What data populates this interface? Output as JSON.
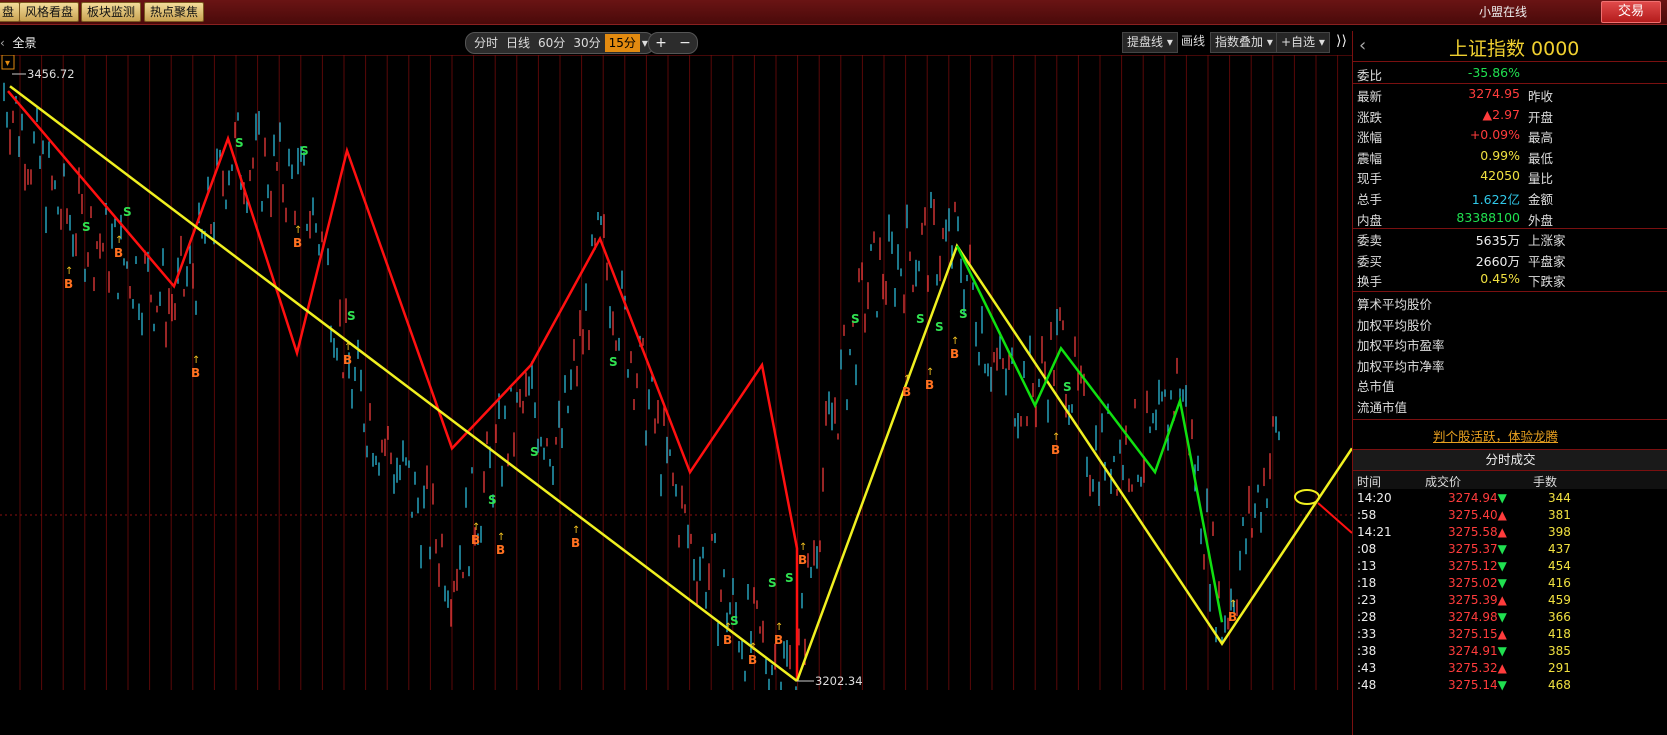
{
  "topbar": {
    "buttons": [
      "盘",
      "风格看盘",
      "板块监测",
      "热点聚焦"
    ],
    "online_label": "小盟在线",
    "trade_label": "交易"
  },
  "toolbar": {
    "left_label": "全景",
    "periods": [
      "分时",
      "日线",
      "60分",
      "30分",
      "15分"
    ],
    "active_period": "15分",
    "zoom_in": "+",
    "zoom_out": "−",
    "tools": [
      "提盘线",
      "画线",
      "指数叠加",
      "+自选"
    ]
  },
  "chart_data": {
    "type": "line",
    "title": "",
    "price_high_label": "3456.72",
    "price_low_label": "3202.34",
    "signal_buy": "B",
    "signal_sell": "S",
    "ylim": [
      3202.34,
      3456.72
    ],
    "colors": {
      "price_up": "#ff4040",
      "price_down": "#30c8e8",
      "red_wave": "#ff1010",
      "yellow_trend": "#f0f020",
      "green_wave": "#10e010",
      "grid": "#5a0808"
    },
    "red_wave": [
      3450,
      3368,
      3430,
      3340,
      3425,
      3300,
      3335,
      3388,
      3290,
      3335,
      3258,
      3202.34
    ],
    "yellow_trend_1": [
      3452,
      3202.34
    ],
    "yellow_wave_2": [
      3202.34,
      3385,
      3218,
      3300
    ],
    "green_wave": [
      3385,
      3318,
      3342,
      3290,
      3320,
      3227
    ],
    "buy_signals": 16,
    "sell_signals": 16
  },
  "sidebar": {
    "back": "‹",
    "title": "上证指数 0000",
    "wei_bi_label": "委比",
    "wei_bi": "-35.86%",
    "quote": [
      {
        "label": "最新",
        "value": "3274.95",
        "right": "昨收",
        "color": "red"
      },
      {
        "label": "涨跌",
        "value": "▲2.97",
        "right": "开盘",
        "color": "red"
      },
      {
        "label": "涨幅",
        "value": "+0.09%",
        "right": "最高",
        "color": "red"
      },
      {
        "label": "震幅",
        "value": "0.99%",
        "right": "最低",
        "color": "yellow"
      },
      {
        "label": "现手",
        "value": "42050",
        "right": "量比",
        "color": "yellow"
      },
      {
        "label": "总手",
        "value": "1.622亿",
        "right": "金额",
        "color": "cyan"
      },
      {
        "label": "内盘",
        "value": "83388100",
        "right": "外盘",
        "color": "green"
      }
    ],
    "quote2": [
      {
        "label": "委卖",
        "value": "5635万",
        "right": "上涨家",
        "color": "white"
      },
      {
        "label": "委买",
        "value": "2660万",
        "right": "平盘家",
        "color": "white"
      },
      {
        "label": "换手",
        "value": "0.45%",
        "right": "下跌家",
        "color": "yellow"
      }
    ],
    "stats": [
      "算术平均股价",
      "加权平均股价",
      "加权平均市盈率",
      "加权平均市净率",
      "总市值",
      "流通市值"
    ],
    "promo": "判个股活跃，体验龙腾",
    "ticks_title": "分时成交",
    "tick_cols": [
      "时间",
      "成交价",
      "手数"
    ],
    "ticks": [
      {
        "t": "14:20",
        "p": "3274.94",
        "d": "▼",
        "q": "344"
      },
      {
        "t": ":58",
        "p": "3275.40",
        "d": "▲",
        "q": "381"
      },
      {
        "t": "14:21",
        "p": "3275.58",
        "d": "▲",
        "q": "398"
      },
      {
        "t": ":08",
        "p": "3275.37",
        "d": "▼",
        "q": "437"
      },
      {
        "t": ":13",
        "p": "3275.12",
        "d": "▼",
        "q": "454"
      },
      {
        "t": ":18",
        "p": "3275.02",
        "d": "▼",
        "q": "416"
      },
      {
        "t": ":23",
        "p": "3275.39",
        "d": "▲",
        "q": "459"
      },
      {
        "t": ":28",
        "p": "3274.98",
        "d": "▼",
        "q": "366"
      },
      {
        "t": ":33",
        "p": "3275.15",
        "d": "▲",
        "q": "418"
      },
      {
        "t": ":38",
        "p": "3274.91",
        "d": "▼",
        "q": "385"
      },
      {
        "t": ":43",
        "p": "3275.32",
        "d": "▲",
        "q": "291"
      },
      {
        "t": ":48",
        "p": "3275.14",
        "d": "▼",
        "q": "468"
      }
    ]
  }
}
